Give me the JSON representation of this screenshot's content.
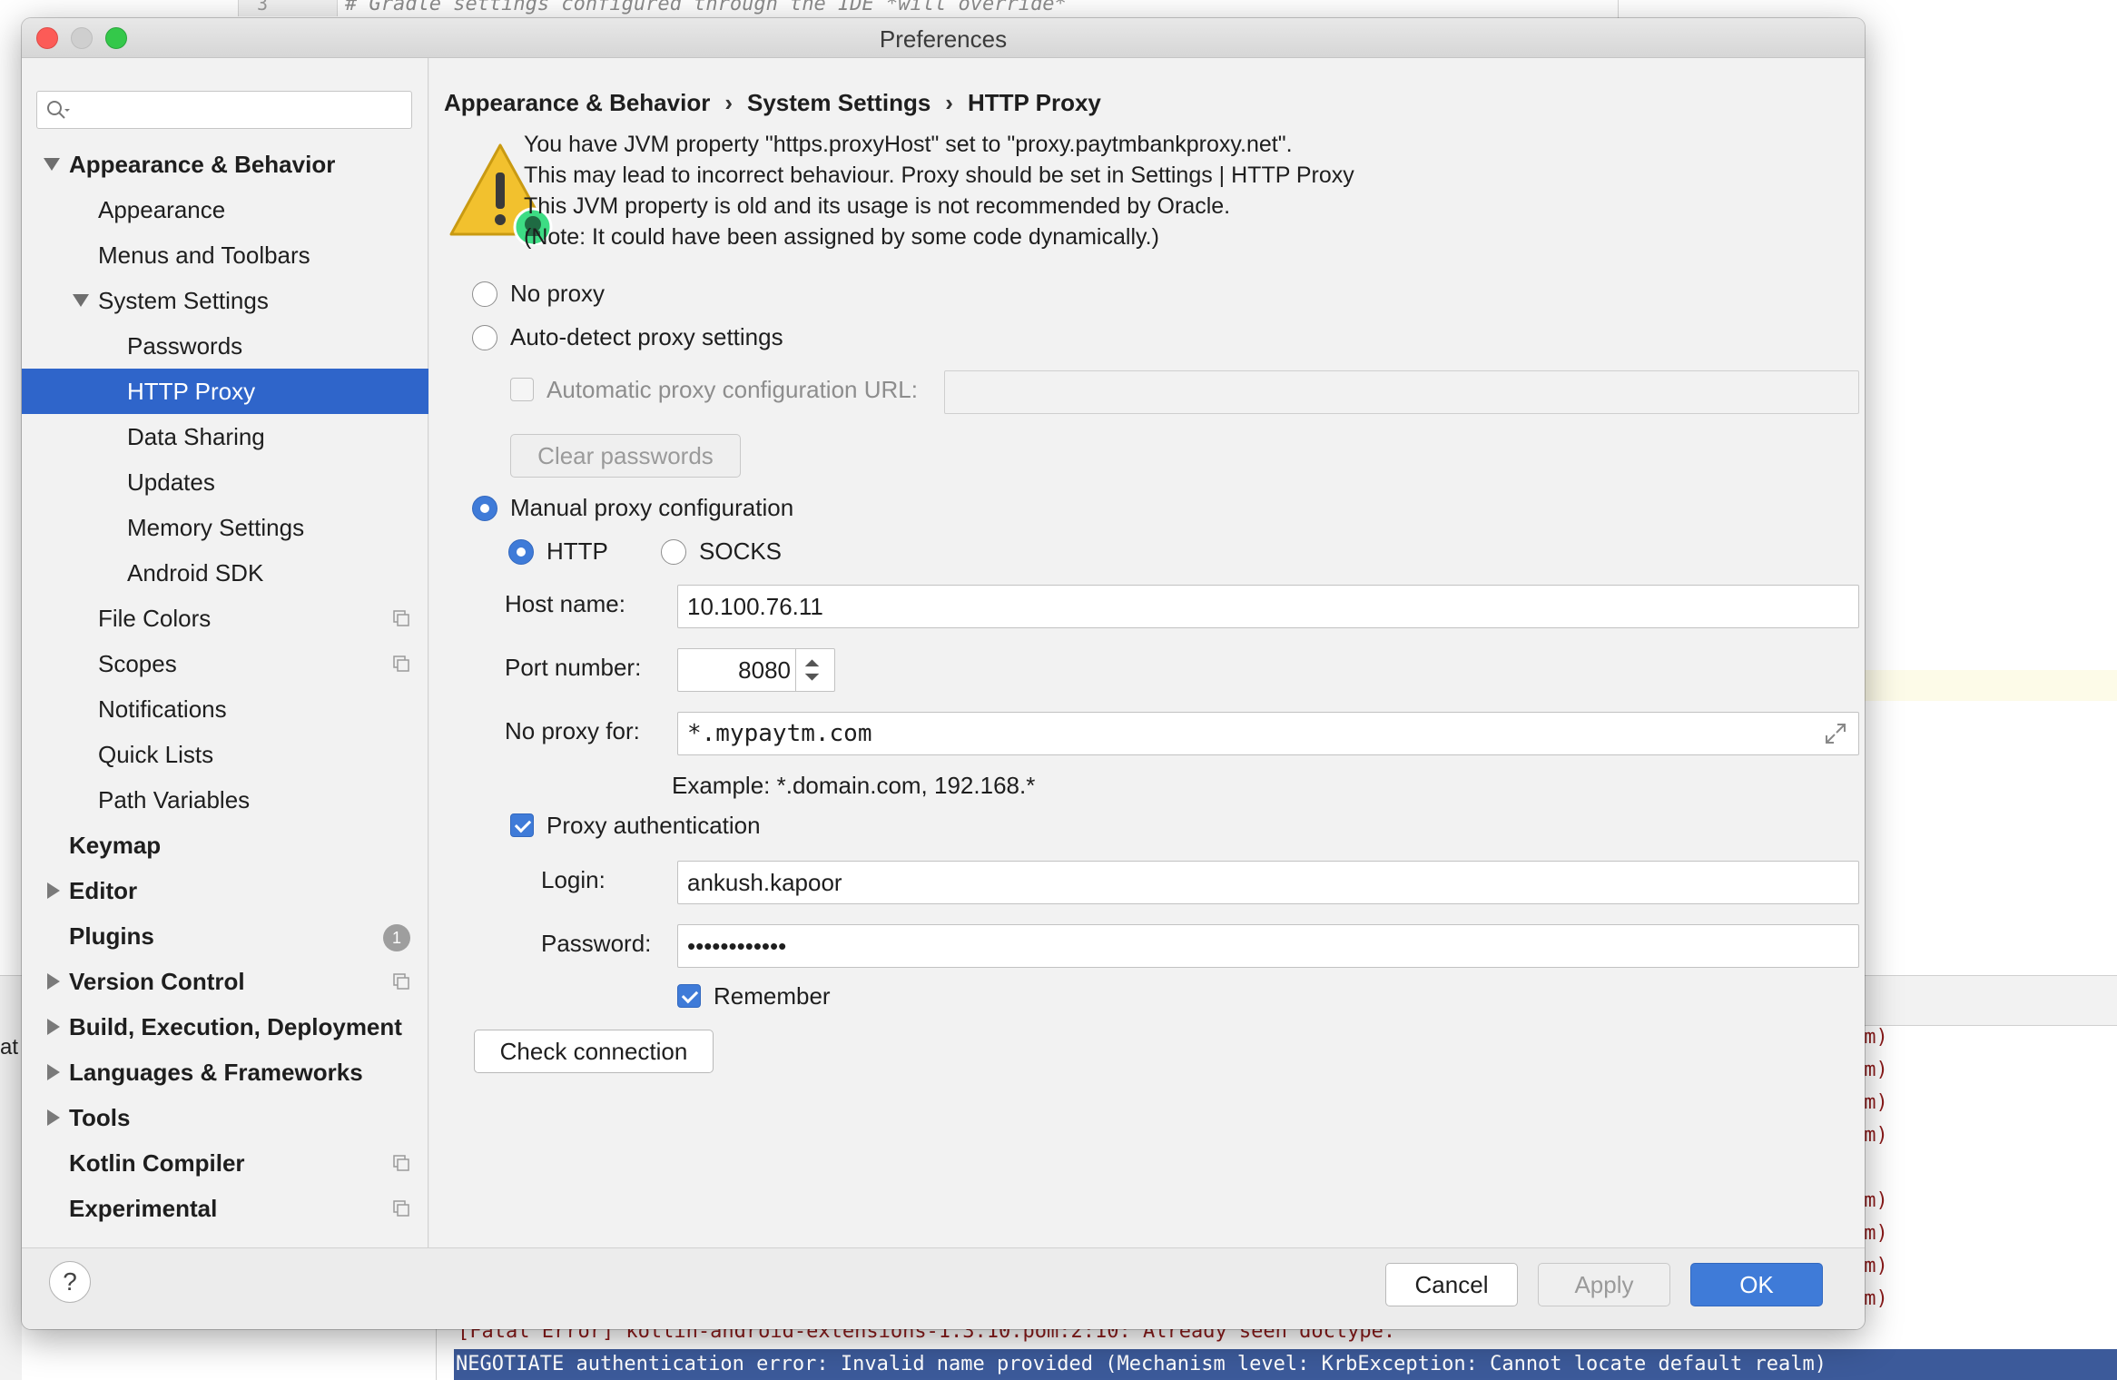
{
  "ide": {
    "gutter_text": "3",
    "code_text": "# Gradle settings configured through the IDE *will override*",
    "left_text": "at",
    "console_tail": "lm)",
    "console_fatal": "[Fatal Error] kotlin-android-extensions-1.3.10.pom:2:10: Already seen doctype.",
    "console_selected": "NEGOTIATE authentication error: Invalid name provided (Mechanism level: KrbException: Cannot locate default realm)"
  },
  "window": {
    "title": "Preferences"
  },
  "sidebar": {
    "search_placeholder": "",
    "items": [
      {
        "label": "Appearance & Behavior",
        "bold": true,
        "arrow": "down",
        "indent": 0
      },
      {
        "label": "Appearance",
        "indent": 1
      },
      {
        "label": "Menus and Toolbars",
        "indent": 1
      },
      {
        "label": "System Settings",
        "arrow": "down",
        "indent": 1
      },
      {
        "label": "Passwords",
        "indent": 2
      },
      {
        "label": "HTTP Proxy",
        "indent": 2,
        "selected": true
      },
      {
        "label": "Data Sharing",
        "indent": 2
      },
      {
        "label": "Updates",
        "indent": 2
      },
      {
        "label": "Memory Settings",
        "indent": 2
      },
      {
        "label": "Android SDK",
        "indent": 2
      },
      {
        "label": "File Colors",
        "indent": 1,
        "project_icon": true
      },
      {
        "label": "Scopes",
        "indent": 1,
        "project_icon": true
      },
      {
        "label": "Notifications",
        "indent": 1
      },
      {
        "label": "Quick Lists",
        "indent": 1
      },
      {
        "label": "Path Variables",
        "indent": 1
      },
      {
        "label": "Keymap",
        "bold": true,
        "indent": 0
      },
      {
        "label": "Editor",
        "bold": true,
        "arrow": "right",
        "indent": 0
      },
      {
        "label": "Plugins",
        "bold": true,
        "indent": 0,
        "badge": "1"
      },
      {
        "label": "Version Control",
        "bold": true,
        "arrow": "right",
        "indent": 0,
        "project_icon": true
      },
      {
        "label": "Build, Execution, Deployment",
        "bold": true,
        "arrow": "right",
        "indent": 0
      },
      {
        "label": "Languages & Frameworks",
        "bold": true,
        "arrow": "right",
        "indent": 0
      },
      {
        "label": "Tools",
        "bold": true,
        "arrow": "right",
        "indent": 0
      },
      {
        "label": "Kotlin Compiler",
        "bold": true,
        "indent": 0,
        "project_icon": true
      },
      {
        "label": "Experimental",
        "bold": true,
        "indent": 0,
        "project_icon": true
      }
    ]
  },
  "breadcrumb": {
    "items": [
      "Appearance & Behavior",
      "System Settings",
      "HTTP Proxy"
    ],
    "separator": "›"
  },
  "warning": {
    "lines": [
      "You have JVM property \"https.proxyHost\" set to \"proxy.paytmbankproxy.net\".",
      "This may lead to incorrect behaviour. Proxy should be set in Settings | HTTP Proxy",
      "This JVM property is old and its usage is not recommended by Oracle.",
      "(Note: It could have been assigned by some code dynamically.)"
    ]
  },
  "proxy": {
    "no_proxy_label": "No proxy",
    "auto_detect_label": "Auto-detect proxy settings",
    "auto_config_url_label": "Automatic proxy configuration URL:",
    "auto_config_url_value": "",
    "clear_passwords_label": "Clear passwords",
    "manual_label": "Manual proxy configuration",
    "http_label": "HTTP",
    "socks_label": "SOCKS",
    "host_label": "Host name:",
    "host_value": "10.100.76.11",
    "port_label": "Port number:",
    "port_value": "8080",
    "no_proxy_for_label": "No proxy for:",
    "no_proxy_for_value": "*.mypaytm.com",
    "example_text": "Example: *.domain.com, 192.168.*",
    "auth_label": "Proxy authentication",
    "login_label": "Login:",
    "login_value": "ankush.kapoor",
    "password_label": "Password:",
    "password_value": "••••••••••••",
    "remember_label": "Remember",
    "check_connection_label": "Check connection"
  },
  "footer": {
    "help_label": "?",
    "cancel_label": "Cancel",
    "apply_label": "Apply",
    "ok_label": "OK"
  },
  "colors": {
    "selection": "#2f65ca",
    "accent": "#3f7bd8",
    "warning": "#f2c12e"
  }
}
